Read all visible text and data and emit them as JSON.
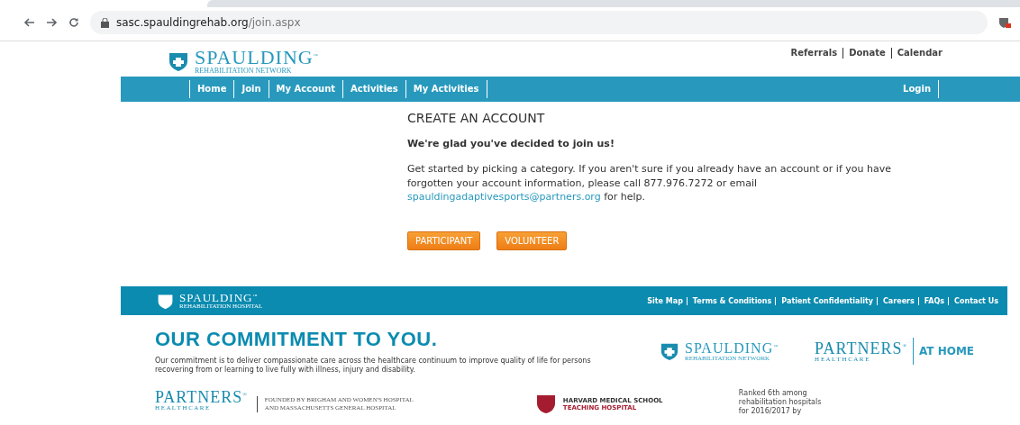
{
  "browser": {
    "url_host": "sasc.spauldingrehab.org",
    "url_path": "/join.aspx"
  },
  "header": {
    "logo": {
      "name": "SPAULDING",
      "mark": "™",
      "subtitle": "REHABILITATION NETWORK"
    },
    "links": [
      "Referrals",
      "Donate",
      "Calendar"
    ]
  },
  "nav": {
    "items": [
      "Home",
      "Join",
      "My Account",
      "Activities",
      "My Activities"
    ],
    "login": "Login"
  },
  "main": {
    "title": "CREATE AN ACCOUNT",
    "subtitle": "We're glad you've decided to join us!",
    "body": "Get started by picking a category. If you aren't sure if you already have an account or if you have forgotten your account information, please call 877.976.7272 or email",
    "email": "spauldingadaptivesports@partners.org",
    "body_end": "for help.",
    "buttons": [
      "PARTICIPANT",
      "VOLUNTEER"
    ]
  },
  "footer": {
    "logo": {
      "name": "SPAULDING",
      "mark": "™",
      "subtitle": "REHABILITATION HOSPITAL"
    },
    "links": [
      "Site Map",
      "Terms & Conditions",
      "Patient Confidentiality",
      "Careers",
      "FAQs",
      "Contact Us"
    ]
  },
  "commitment": {
    "title": "OUR COMMITMENT TO YOU.",
    "text": "Our commitment is to deliver compassionate care across the healthcare continuum to improve quality of life for persons recovering from or learning to live fully with illness, injury and disability."
  },
  "partner_logos": {
    "spaulding": {
      "name": "SPAULDING",
      "mark": "™",
      "subtitle": "REHABILITATION NETWORK"
    },
    "partners": {
      "name": "PARTNERS",
      "mark": "®",
      "subtitle": "H E A L T H C A R E"
    },
    "at_home": "AT HOME"
  },
  "bottom": {
    "partners": {
      "name": "PARTNERS",
      "mark": "®",
      "subtitle": "H E A L T H C A R E"
    },
    "founded": [
      "FOUNDED BY BRIGHAM AND WOMEN'S HOSPITAL",
      "AND MASSACHUSETTS GENERAL HOSPITAL"
    ],
    "harvard": [
      "HARVARD MEDICAL SCHOOL",
      "TEACHING HOSPITAL"
    ],
    "ranked": [
      "Ranked 6th among",
      "rehabilitation hospitals",
      "for 2016/2017 by"
    ]
  }
}
